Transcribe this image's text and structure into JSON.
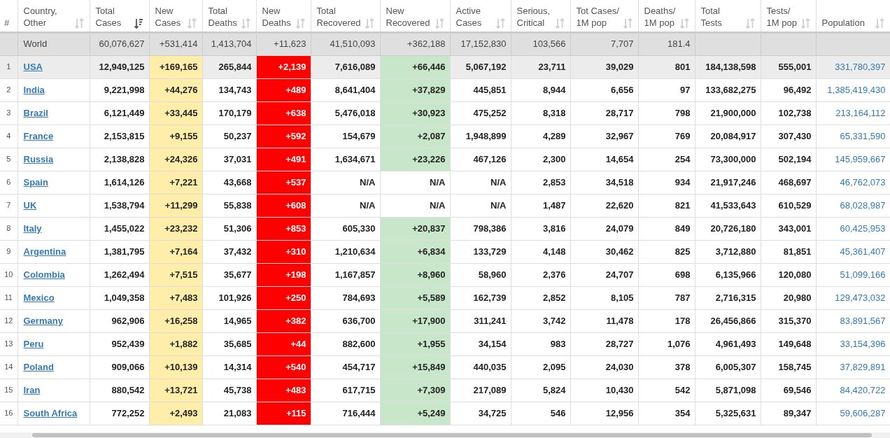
{
  "table": {
    "columns": [
      {
        "label": "#",
        "kind": "rank"
      },
      {
        "label": "Country,\nOther",
        "kind": "country",
        "sorted": false
      },
      {
        "label": "Total\nCases",
        "kind": "plain",
        "sorted": true
      },
      {
        "label": "New\nCases",
        "kind": "new_cases",
        "sorted": false
      },
      {
        "label": "Total\nDeaths",
        "kind": "plain",
        "sorted": false
      },
      {
        "label": "New\nDeaths",
        "kind": "new_deaths",
        "sorted": false
      },
      {
        "label": "Total\nRecovered",
        "kind": "plain",
        "sorted": false
      },
      {
        "label": "New\nRecovered",
        "kind": "new_recovered",
        "sorted": false
      },
      {
        "label": "Active\nCases",
        "kind": "plain",
        "sorted": false
      },
      {
        "label": "Serious,\nCritical",
        "kind": "plain",
        "sorted": false
      },
      {
        "label": "Tot Cases/\n1M pop",
        "kind": "plain",
        "sorted": false
      },
      {
        "label": "Deaths/\n1M pop",
        "kind": "plain",
        "sorted": false
      },
      {
        "label": "Total\nTests",
        "kind": "plain",
        "sorted": false
      },
      {
        "label": "Tests/\n1M pop",
        "kind": "plain",
        "sorted": false
      },
      {
        "label": "Population",
        "kind": "population",
        "sorted": false
      }
    ],
    "total_row": {
      "cells": [
        "",
        "World",
        "60,076,627",
        "+531,414",
        "1,413,704",
        "+11,623",
        "41,510,093",
        "+362,188",
        "17,152,830",
        "103,566",
        "7,707",
        "181.4",
        "",
        "",
        ""
      ]
    },
    "rows": [
      {
        "highlighted": true,
        "recovered_shaded": true,
        "cells": [
          "1",
          "USA",
          "12,949,125",
          "+169,165",
          "265,844",
          "+2,139",
          "7,616,089",
          "+66,446",
          "5,067,192",
          "23,711",
          "39,029",
          "801",
          "184,138,598",
          "555,001",
          "331,780,397"
        ]
      },
      {
        "highlighted": false,
        "recovered_shaded": true,
        "cells": [
          "2",
          "India",
          "9,221,998",
          "+44,276",
          "134,743",
          "+489",
          "8,641,404",
          "+37,829",
          "445,851",
          "8,944",
          "6,656",
          "97",
          "133,682,275",
          "96,492",
          "1,385,419,430"
        ]
      },
      {
        "highlighted": false,
        "recovered_shaded": true,
        "cells": [
          "3",
          "Brazil",
          "6,121,449",
          "+33,445",
          "170,179",
          "+638",
          "5,476,018",
          "+30,923",
          "475,252",
          "8,318",
          "28,717",
          "798",
          "21,900,000",
          "102,738",
          "213,164,112"
        ]
      },
      {
        "highlighted": false,
        "recovered_shaded": true,
        "cells": [
          "4",
          "France",
          "2,153,815",
          "+9,155",
          "50,237",
          "+592",
          "154,679",
          "+2,087",
          "1,948,899",
          "4,289",
          "32,967",
          "769",
          "20,084,917",
          "307,430",
          "65,331,590"
        ]
      },
      {
        "highlighted": false,
        "recovered_shaded": true,
        "cells": [
          "5",
          "Russia",
          "2,138,828",
          "+24,326",
          "37,031",
          "+491",
          "1,634,671",
          "+23,226",
          "467,126",
          "2,300",
          "14,654",
          "254",
          "73,300,000",
          "502,194",
          "145,959,667"
        ]
      },
      {
        "highlighted": false,
        "recovered_shaded": false,
        "cells": [
          "6",
          "Spain",
          "1,614,126",
          "+7,221",
          "43,668",
          "+537",
          "N/A",
          "N/A",
          "N/A",
          "2,853",
          "34,518",
          "934",
          "21,917,246",
          "468,697",
          "46,762,073"
        ]
      },
      {
        "highlighted": false,
        "recovered_shaded": false,
        "cells": [
          "7",
          "UK",
          "1,538,794",
          "+11,299",
          "55,838",
          "+608",
          "N/A",
          "N/A",
          "N/A",
          "1,487",
          "22,620",
          "821",
          "41,533,643",
          "610,529",
          "68,028,987"
        ]
      },
      {
        "highlighted": false,
        "recovered_shaded": true,
        "cells": [
          "8",
          "Italy",
          "1,455,022",
          "+23,232",
          "51,306",
          "+853",
          "605,330",
          "+20,837",
          "798,386",
          "3,816",
          "24,079",
          "849",
          "20,726,180",
          "343,001",
          "60,425,953"
        ]
      },
      {
        "highlighted": false,
        "recovered_shaded": true,
        "cells": [
          "9",
          "Argentina",
          "1,381,795",
          "+7,164",
          "37,432",
          "+310",
          "1,210,634",
          "+6,834",
          "133,729",
          "4,148",
          "30,462",
          "825",
          "3,712,880",
          "81,851",
          "45,361,407"
        ]
      },
      {
        "highlighted": false,
        "recovered_shaded": true,
        "cells": [
          "10",
          "Colombia",
          "1,262,494",
          "+7,515",
          "35,677",
          "+198",
          "1,167,857",
          "+8,960",
          "58,960",
          "2,376",
          "24,707",
          "698",
          "6,135,966",
          "120,080",
          "51,099,166"
        ]
      },
      {
        "highlighted": false,
        "recovered_shaded": true,
        "cells": [
          "11",
          "Mexico",
          "1,049,358",
          "+7,483",
          "101,926",
          "+250",
          "784,693",
          "+5,589",
          "162,739",
          "2,852",
          "8,105",
          "787",
          "2,716,315",
          "20,980",
          "129,473,032"
        ]
      },
      {
        "highlighted": false,
        "recovered_shaded": true,
        "cells": [
          "12",
          "Germany",
          "962,906",
          "+16,258",
          "14,965",
          "+382",
          "636,700",
          "+17,900",
          "311,241",
          "3,742",
          "11,478",
          "178",
          "26,456,866",
          "315,370",
          "83,891,567"
        ]
      },
      {
        "highlighted": false,
        "recovered_shaded": true,
        "cells": [
          "13",
          "Peru",
          "952,439",
          "+1,882",
          "35,685",
          "+44",
          "882,600",
          "+1,955",
          "34,154",
          "983",
          "28,727",
          "1,076",
          "4,961,493",
          "149,648",
          "33,154,396"
        ]
      },
      {
        "highlighted": false,
        "recovered_shaded": true,
        "cells": [
          "14",
          "Poland",
          "909,066",
          "+10,139",
          "14,314",
          "+540",
          "454,717",
          "+15,849",
          "440,035",
          "2,095",
          "24,030",
          "378",
          "6,005,307",
          "158,745",
          "37,829,891"
        ]
      },
      {
        "highlighted": false,
        "recovered_shaded": true,
        "cells": [
          "15",
          "Iran",
          "880,542",
          "+13,721",
          "45,738",
          "+483",
          "617,715",
          "+7,309",
          "217,089",
          "5,824",
          "10,430",
          "542",
          "5,871,098",
          "69,546",
          "84,420,722"
        ]
      },
      {
        "highlighted": false,
        "recovered_shaded": true,
        "cells": [
          "16",
          "South Africa",
          "772,252",
          "+2,493",
          "21,083",
          "+115",
          "716,444",
          "+5,249",
          "34,725",
          "546",
          "12,956",
          "354",
          "5,325,631",
          "89,347",
          "59,606,287"
        ]
      }
    ]
  }
}
